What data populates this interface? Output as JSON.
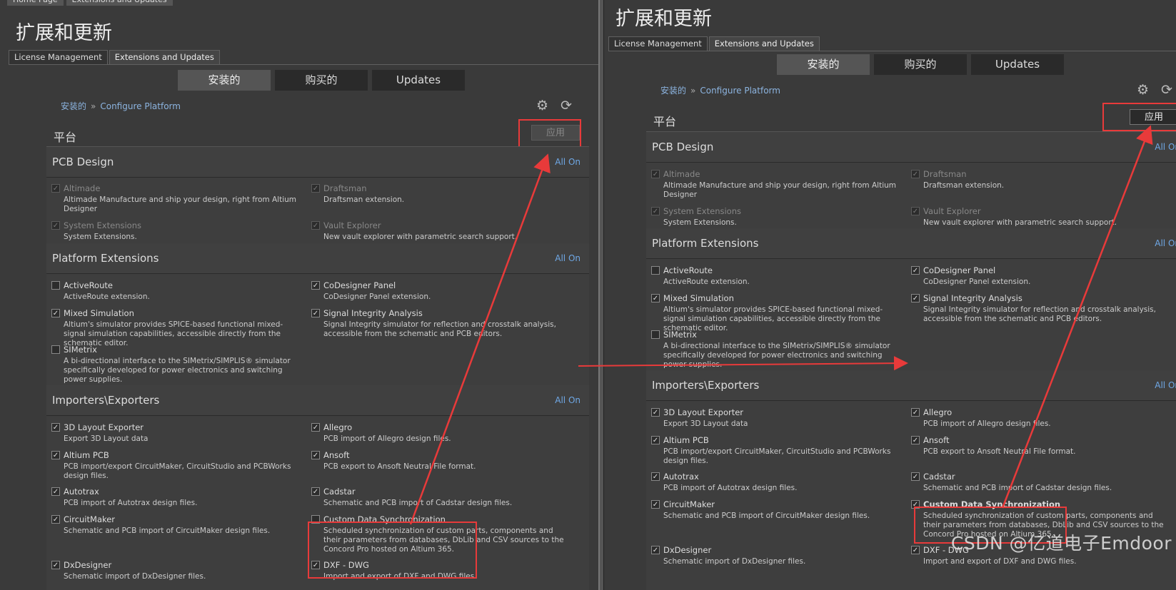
{
  "window_tabs": [
    "Home Page",
    "Extensions and Updates"
  ],
  "title": "扩展和更新",
  "subtabs": [
    "License Management",
    "Extensions and Updates"
  ],
  "segments": [
    "安装的",
    "购买的",
    "Updates"
  ],
  "breadcrumb": {
    "root": "安装的",
    "sep": "»",
    "leaf": "Configure Platform"
  },
  "platform_label": "平台",
  "apply_label": "应用",
  "all_on": "All On",
  "icons": {
    "settings": "gear-icon",
    "refresh": "refresh-icon"
  },
  "colors": {
    "accent": "#6fa8e6",
    "annotation": "#e83a3a"
  },
  "sections": {
    "pcb": {
      "title": "PCB Design",
      "items": [
        {
          "name": "Altimade",
          "desc": "Altimade Manufacture and ship your design, right from Altium Designer",
          "checked": true,
          "disabled": true
        },
        {
          "name": "Draftsman",
          "desc": "Draftsman extension.",
          "checked": true,
          "disabled": true
        },
        {
          "name": "System Extensions",
          "desc": "System Extensions.",
          "checked": true,
          "disabled": true
        },
        {
          "name": "Vault Explorer",
          "desc": "New vault explorer with parametric search support.",
          "checked": true,
          "disabled": true
        }
      ]
    },
    "platform": {
      "title": "Platform Extensions",
      "items": [
        {
          "name": "ActiveRoute",
          "desc": "ActiveRoute extension.",
          "checked": false
        },
        {
          "name": "CoDesigner Panel",
          "desc": "CoDesigner Panel extension.",
          "checked": true
        },
        {
          "name": "Mixed Simulation",
          "desc": "Altium's simulator provides SPICE-based functional mixed-signal simulation capabilities, accessible directly from the schematic editor.",
          "checked": true
        },
        {
          "name": "Signal Integrity Analysis",
          "desc": "Signal Integrity simulator for reflection and crosstalk analysis, accessible from the schematic and PCB editors.",
          "checked": true
        },
        {
          "name": "SIMetrix",
          "desc": "A bi-directional interface to the SIMetrix/SIMPLIS® simulator specifically developed for power electronics and switching power supplies.",
          "checked": false
        }
      ]
    },
    "importers": {
      "title": "Importers\\Exporters",
      "items": [
        {
          "name": "3D Layout Exporter",
          "desc": "Export 3D Layout data",
          "checked": true
        },
        {
          "name": "Allegro",
          "desc": "PCB import of Allegro design files.",
          "checked": true
        },
        {
          "name": "Altium PCB",
          "desc": "PCB import/export CircuitMaker, CircuitStudio and PCBWorks design files.",
          "checked": true
        },
        {
          "name": "Ansoft",
          "desc": "PCB export to Ansoft Neutral File format.",
          "checked": true
        },
        {
          "name": "Autotrax",
          "desc": "PCB import of Autotrax design files.",
          "checked": true
        },
        {
          "name": "Cadstar",
          "desc": "Schematic and PCB import of Cadstar design files.",
          "checked": true
        },
        {
          "name": "CircuitMaker",
          "desc": "Schematic and PCB import of CircuitMaker design files.",
          "checked": true
        },
        {
          "name": "Custom Data Synchronization",
          "desc": "Scheduled synchronization of custom parts, components and their parameters from databases, DbLib and CSV sources to the Concord Pro hosted on Altium 365.",
          "checked": false
        },
        {
          "name": "DxDesigner",
          "desc": "Schematic import of DxDesigner files.",
          "checked": true
        },
        {
          "name": "DXF - DWG",
          "desc": "Import and export of DXF and DWG files.",
          "checked": true
        }
      ]
    }
  },
  "custom_sync_after": {
    "checked": true
  },
  "watermark": "CSDN @亿道电子Emdoor"
}
